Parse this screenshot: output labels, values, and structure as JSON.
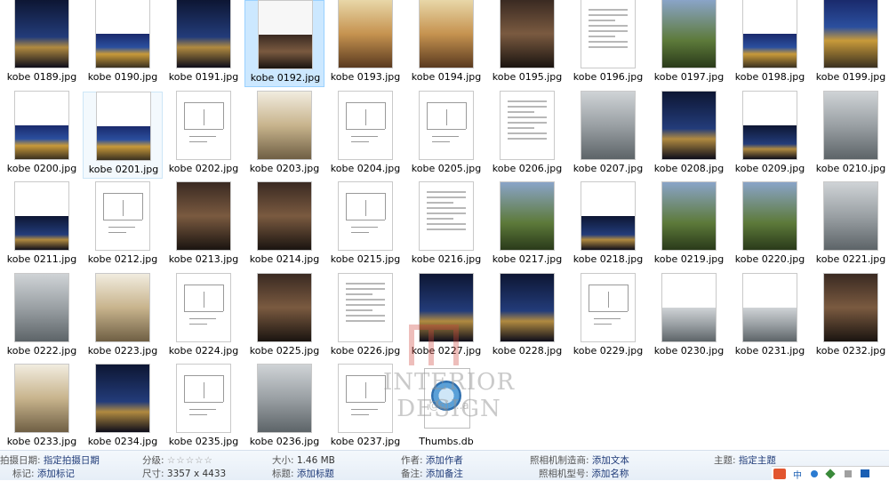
{
  "files": [
    {
      "name": "kobe 0189.jpg",
      "style": "t-photo-night"
    },
    {
      "name": "kobe 0190.jpg",
      "style": "split-blue"
    },
    {
      "name": "kobe 0191.jpg",
      "style": "t-photo-night"
    },
    {
      "name": "kobe 0192.jpg",
      "style": "split-doc",
      "selected": true
    },
    {
      "name": "kobe 0193.jpg",
      "style": "t-photo-warm"
    },
    {
      "name": "kobe 0194.jpg",
      "style": "t-photo-warm"
    },
    {
      "name": "kobe 0195.jpg",
      "style": "t-photo-dark"
    },
    {
      "name": "kobe 0196.jpg",
      "style": "doc"
    },
    {
      "name": "kobe 0197.jpg",
      "style": "t-photo-green"
    },
    {
      "name": "kobe 0198.jpg",
      "style": "split-blue"
    },
    {
      "name": "kobe 0199.jpg",
      "style": "t-photo-blue"
    },
    {
      "name": "kobe 0200.jpg",
      "style": "split-blue"
    },
    {
      "name": "kobe 0201.jpg",
      "style": "split-blue",
      "hover": true
    },
    {
      "name": "kobe 0202.jpg",
      "style": "drawing"
    },
    {
      "name": "kobe 0203.jpg",
      "style": "t-photo-interior"
    },
    {
      "name": "kobe 0204.jpg",
      "style": "drawing"
    },
    {
      "name": "kobe 0205.jpg",
      "style": "drawing"
    },
    {
      "name": "kobe 0206.jpg",
      "style": "doc"
    },
    {
      "name": "kobe 0207.jpg",
      "style": "t-photo-grey"
    },
    {
      "name": "kobe 0208.jpg",
      "style": "t-photo-night"
    },
    {
      "name": "kobe 0209.jpg",
      "style": "split-night"
    },
    {
      "name": "kobe 0210.jpg",
      "style": "t-photo-grey"
    },
    {
      "name": "kobe 0211.jpg",
      "style": "split-night"
    },
    {
      "name": "kobe 0212.jpg",
      "style": "drawing"
    },
    {
      "name": "kobe 0213.jpg",
      "style": "t-photo-dark"
    },
    {
      "name": "kobe 0214.jpg",
      "style": "t-photo-dark"
    },
    {
      "name": "kobe 0215.jpg",
      "style": "drawing"
    },
    {
      "name": "kobe 0216.jpg",
      "style": "doc"
    },
    {
      "name": "kobe 0217.jpg",
      "style": "t-photo-green"
    },
    {
      "name": "kobe 0218.jpg",
      "style": "split-night"
    },
    {
      "name": "kobe 0219.jpg",
      "style": "t-photo-green"
    },
    {
      "name": "kobe 0220.jpg",
      "style": "t-photo-green"
    },
    {
      "name": "kobe 0221.jpg",
      "style": "t-photo-grey"
    },
    {
      "name": "kobe 0222.jpg",
      "style": "t-photo-grey"
    },
    {
      "name": "kobe 0223.jpg",
      "style": "t-photo-interior"
    },
    {
      "name": "kobe 0224.jpg",
      "style": "drawing"
    },
    {
      "name": "kobe 0225.jpg",
      "style": "t-photo-dark"
    },
    {
      "name": "kobe 0226.jpg",
      "style": "doc"
    },
    {
      "name": "kobe 0227.jpg",
      "style": "t-photo-night"
    },
    {
      "name": "kobe 0228.jpg",
      "style": "t-photo-night"
    },
    {
      "name": "kobe 0229.jpg",
      "style": "drawing"
    },
    {
      "name": "kobe 0230.jpg",
      "style": "split-grey"
    },
    {
      "name": "kobe 0231.jpg",
      "style": "split-grey"
    },
    {
      "name": "kobe 0232.jpg",
      "style": "t-photo-dark"
    },
    {
      "name": "kobe 0233.jpg",
      "style": "t-photo-interior"
    },
    {
      "name": "kobe 0234.jpg",
      "style": "t-photo-night"
    },
    {
      "name": "kobe 0235.jpg",
      "style": "drawing"
    },
    {
      "name": "kobe 0236.jpg",
      "style": "t-photo-grey"
    },
    {
      "name": "kobe 0237.jpg",
      "style": "drawing"
    },
    {
      "name": "Thumbs.db",
      "style": "db"
    }
  ],
  "watermark": {
    "text": "INTERIOR DESIGN",
    "sub": "@ni·...a"
  },
  "details": {
    "date_taken_label": "拍摄日期:",
    "date_taken_value": "指定拍摄日期",
    "tags_label": "标记:",
    "tags_value": "添加标记",
    "rating_label": "分级:",
    "rating_stars": "☆☆☆☆☆",
    "dimensions_label": "尺寸:",
    "dimensions_value": "3357 x 4433",
    "size_label": "大小:",
    "size_value": "1.46 MB",
    "title_label": "标题:",
    "title_value": "添加标题",
    "author_label": "作者:",
    "author_value": "添加作者",
    "comments_label": "备注:",
    "comments_value": "添加备注",
    "maker_label": "照相机制造商:",
    "maker_value": "添加文本",
    "model_label": "照相机型号:",
    "model_value": "添加名称",
    "subject_label": "主题:",
    "subject_value": "指定主题"
  }
}
